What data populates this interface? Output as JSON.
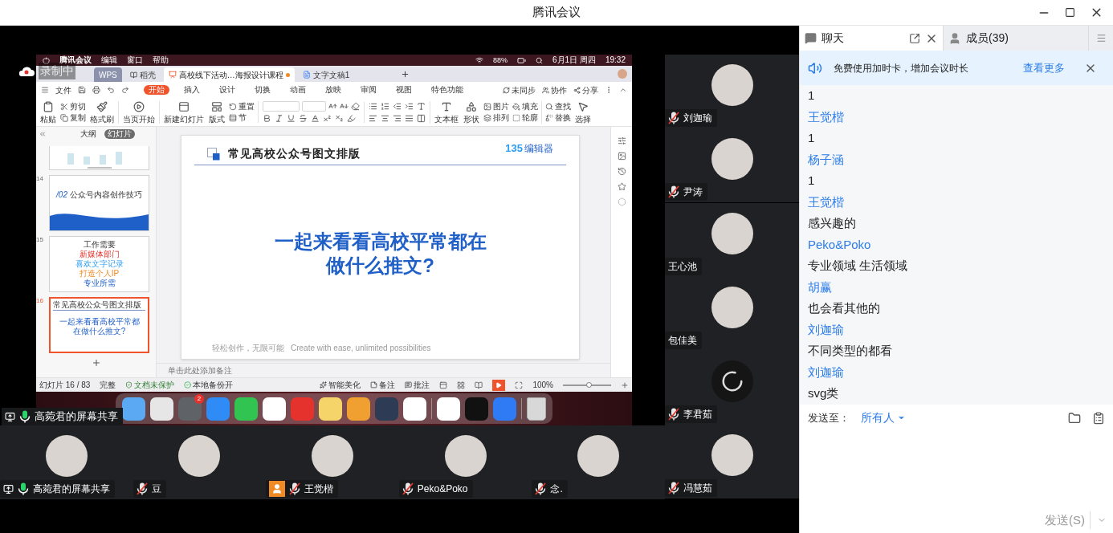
{
  "window": {
    "title": "腾讯会议"
  },
  "share": {
    "recording": "录制中",
    "sharer_label": "高菀君的屏幕共享",
    "sharer_muted": false,
    "desktop": {
      "menubar": {
        "items": [
          "腾讯会议",
          "编辑",
          "窗口",
          "帮助"
        ],
        "battery": "88%",
        "date": "6月1日 周四",
        "time": "19:32"
      },
      "dock": {
        "badge": "2"
      }
    },
    "wps": {
      "tabs": [
        {
          "kind": "home",
          "label": "WPS",
          "selected": false,
          "unsaved": false
        },
        {
          "kind": "template",
          "label": "稻壳",
          "selected": false,
          "unsaved": false
        },
        {
          "kind": "slides",
          "label": "高校线下活动…海报设计课程",
          "selected": true,
          "unsaved": true
        },
        {
          "kind": "document",
          "label": "文字文稿1",
          "selected": false,
          "unsaved": false
        }
      ],
      "file_menu": "文件",
      "ribbon_tabs": [
        {
          "label": "开始",
          "selected": true
        },
        {
          "label": "插入",
          "selected": false
        },
        {
          "label": "设计",
          "selected": false
        },
        {
          "label": "切换",
          "selected": false
        },
        {
          "label": "动画",
          "selected": false
        },
        {
          "label": "放映",
          "selected": false
        },
        {
          "label": "审阅",
          "selected": false
        },
        {
          "label": "视图",
          "selected": false
        },
        {
          "label": "特色功能",
          "selected": false
        }
      ],
      "actions": [
        "未同步",
        "协作",
        "分享"
      ],
      "toolbar_groups": [
        [
          {
            "kind": "large",
            "label": "粘贴"
          },
          {
            "kind": "stack",
            "labels": [
              "剪切",
              "复制"
            ]
          },
          {
            "kind": "large",
            "label": "格式刷"
          }
        ],
        [
          {
            "kind": "large",
            "label": "当页开始"
          }
        ],
        [
          {
            "kind": "large",
            "label": "新建幻灯片"
          },
          {
            "kind": "large",
            "label": "版式"
          },
          {
            "kind": "stack",
            "labels": [
              "重置",
              "节"
            ]
          }
        ],
        [
          {
            "kind": "font"
          }
        ],
        [
          {
            "kind": "paragraph"
          }
        ],
        [
          {
            "kind": "large",
            "label": "文本框"
          },
          {
            "kind": "large",
            "label": "形状"
          },
          {
            "kind": "stack",
            "labels": [
              "图片",
              "排列"
            ]
          },
          {
            "kind": "stack",
            "labels": [
              "填充",
              "轮廓"
            ]
          }
        ],
        [
          {
            "kind": "stack",
            "labels": [
              "查找",
              "替换"
            ]
          },
          {
            "kind": "large",
            "label": "选择"
          }
        ]
      ],
      "panel_tabs": [
        {
          "label": "大纲",
          "selected": false
        },
        {
          "label": "幻灯片",
          "selected": true
        }
      ],
      "thumbnails": [
        {
          "kind": "chart",
          "selected": false
        },
        {
          "kind": "section",
          "number": "14",
          "mark": "/02",
          "texts": [
            "公众号内容创作技巧"
          ],
          "selected": false
        },
        {
          "kind": "wordcloud",
          "number": "15",
          "texts": [
            "工作需要",
            "新媒体部门",
            "喜欢文字记录",
            "打造个人IP",
            "专业所需"
          ],
          "selected": false
        },
        {
          "kind": "title",
          "number": "16",
          "heading": "常见高校公众号图文排版",
          "texts": [
            "一起来看看高校平常都在做什么推文?"
          ],
          "selected": true
        }
      ],
      "slide": {
        "heading": "常见高校公众号图文排版",
        "logo_mark": "135",
        "logo_text": "编辑器",
        "lines": [
          "一起来看看高校平常都在",
          "做什么推文?"
        ],
        "footer": [
          "轻松创作，无限可能",
          "Create with ease, unlimited possibilities"
        ]
      },
      "notes_placeholder": "单击此处添加备注",
      "status": {
        "slide_count": "幻灯片 16 / 83",
        "theme": "完整",
        "protection": "文档未保护",
        "backup": "本地备份开",
        "beautify": "智能美化",
        "notes": "备注",
        "comments": "批注",
        "zoom": "100%",
        "zoom_slider": {
          "level": 0.53
        }
      }
    }
  },
  "side_participants": [
    {
      "name": "刘迦瑜",
      "mic_shown": true,
      "muted": true,
      "loading": false
    },
    {
      "name": "尹涛",
      "mic_shown": true,
      "muted": true,
      "loading": false
    },
    {
      "name": "王心池",
      "mic_shown": false,
      "loading": false
    },
    {
      "name": "包佳美",
      "mic_shown": false,
      "loading": false
    },
    {
      "name": "李君茹",
      "mic_shown": true,
      "muted": true,
      "loading": true
    },
    {
      "name": "冯慧茹",
      "mic_shown": true,
      "muted": true,
      "loading": false
    }
  ],
  "bottom_participants": [
    {
      "name": "高菀君的屏幕共享",
      "muted": false,
      "sharing": true,
      "host": false
    },
    {
      "name": "豆",
      "muted": true,
      "sharing": false,
      "host": false
    },
    {
      "name": "王觉楷",
      "muted": true,
      "sharing": false,
      "host": true
    },
    {
      "name": "Peko&Poko",
      "muted": true,
      "sharing": false,
      "host": false
    },
    {
      "name": "念.",
      "muted": true,
      "sharing": false,
      "host": false
    }
  ],
  "chat": {
    "tabs": [
      {
        "kind": "chat",
        "label": "聊天",
        "selected": true
      },
      {
        "kind": "members",
        "label": "成员(39)",
        "selected": false
      }
    ],
    "banner": {
      "text": "免费使用加时卡，增加会议时长",
      "link": "查看更多"
    },
    "messages": [
      {
        "kind": "text",
        "text": "1"
      },
      {
        "kind": "sender",
        "text": "王觉楷"
      },
      {
        "kind": "text",
        "text": "1"
      },
      {
        "kind": "sender",
        "text": "杨子涵"
      },
      {
        "kind": "text",
        "text": "1"
      },
      {
        "kind": "sender",
        "text": "王觉楷"
      },
      {
        "kind": "text",
        "text": "感兴趣的"
      },
      {
        "kind": "sender",
        "text": "Peko&Poko"
      },
      {
        "kind": "text",
        "text": "专业领域 生活领域"
      },
      {
        "kind": "sender",
        "text": "胡赢"
      },
      {
        "kind": "text",
        "text": "也会看其他的"
      },
      {
        "kind": "sender",
        "text": "刘迦瑜"
      },
      {
        "kind": "text",
        "text": "不同类型的都看"
      },
      {
        "kind": "sender",
        "text": "刘迦瑜"
      },
      {
        "kind": "text",
        "text": "svg类"
      }
    ],
    "send_to_label": "发送至：",
    "recipient": "所有人",
    "send_button": "发送(S)"
  }
}
